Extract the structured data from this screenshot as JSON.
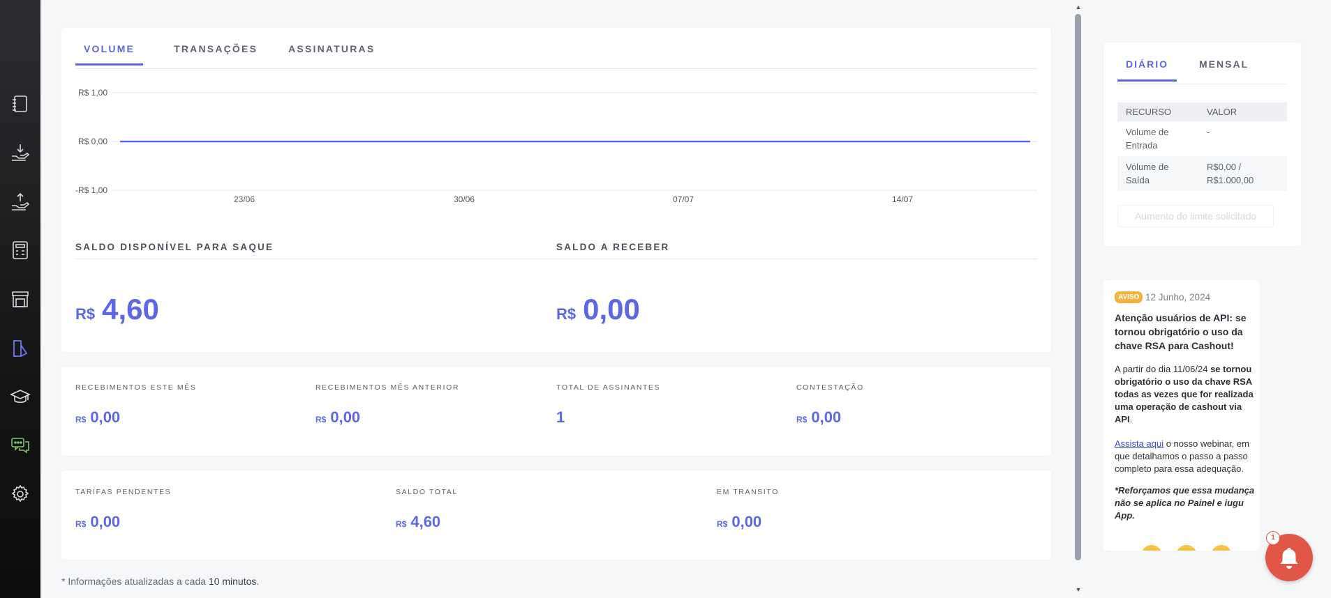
{
  "sidebar": {
    "items": [
      {
        "icon": "notebook-icon"
      },
      {
        "icon": "receive-money-icon"
      },
      {
        "icon": "send-money-icon"
      },
      {
        "icon": "calculator-icon"
      },
      {
        "icon": "store-icon"
      },
      {
        "icon": "reports-icon",
        "active": true
      },
      {
        "icon": "graduation-cap-icon"
      },
      {
        "icon": "chat-icon"
      },
      {
        "icon": "gear-icon"
      }
    ]
  },
  "main_tabs": [
    {
      "label": "VOLUME",
      "active": true
    },
    {
      "label": "TRANSAÇÕES",
      "active": false
    },
    {
      "label": "ASSINATURAS",
      "active": false
    }
  ],
  "chart_data": {
    "type": "line",
    "y_tick_labels": [
      "R$ 1,00",
      "R$ 0,00",
      "-R$ 1,00"
    ],
    "y_ticks": [
      1,
      0,
      -1
    ],
    "ylim": [
      -1,
      1
    ],
    "x_tick_labels": [
      "23/06",
      "30/06",
      "07/07",
      "14/07"
    ],
    "series": [
      {
        "x": [
          "17/06",
          "23/06",
          "30/06",
          "07/07",
          "14/07",
          "20/07"
        ],
        "values": [
          0,
          0,
          0,
          0,
          0,
          0
        ],
        "color": "#5b67e6"
      }
    ],
    "grid": true
  },
  "balance": {
    "available_title": "SALDO DISPONÍVEL PARA SAQUE",
    "available_currency": "R$",
    "available_value": "4,60",
    "receivable_title": "SALDO A RECEBER",
    "receivable_currency": "R$",
    "receivable_value": "0,00"
  },
  "stats_row1": [
    {
      "label": "RECEBIMENTOS ESTE MÊS",
      "currency": "R$",
      "value": "0,00"
    },
    {
      "label": "RECEBIMENTOS MÊS ANTERIOR",
      "currency": "R$",
      "value": "0,00"
    },
    {
      "label": "TOTAL DE ASSINANTES",
      "currency": "",
      "value": "1"
    },
    {
      "label": "CONTESTAÇÃO",
      "currency": "R$",
      "value": "0,00"
    }
  ],
  "stats_row2": [
    {
      "label": "TARIFAS PENDENTES",
      "currency": "R$",
      "value": "0,00"
    },
    {
      "label": "SALDO TOTAL",
      "currency": "R$",
      "value": "4,60"
    },
    {
      "label": "EM TRANSITO",
      "currency": "R$",
      "value": "0,00"
    }
  ],
  "footnote": {
    "prefix": "* Informações atualizadas a cada ",
    "bold": "10 minutos",
    "suffix": "."
  },
  "right_tabs": [
    {
      "label": "DIÁRIO",
      "active": true
    },
    {
      "label": "MENSAL",
      "active": false
    }
  ],
  "limits_table": {
    "headers": [
      "RECURSO",
      "VALOR"
    ],
    "rows": [
      {
        "resource": "Volume de Entrada",
        "value": "-"
      },
      {
        "resource": "Volume de Saída",
        "value": "R$0,00 / R$1.000,00"
      }
    ],
    "button_label": "Aumento do limite solicitado"
  },
  "notice": {
    "badge": "AVISO",
    "date": "12 Junho, 2024",
    "title": "Atenção usuários de API: se tornou obrigatório o uso da chave RSA para Cashout!",
    "body1_prefix": "A partir do dia 11/06/24 ",
    "body1_bold": "se tornou obrigatório o uso da chave RSA todas as vezes que for realizada uma operação de cashout via API",
    "body1_suffix": ".",
    "link_text": "Assista aqui",
    "body2": " o nosso webinar, em que detalhamos o passo a passo completo para essa adequação.",
    "note": "*Reforçamos que essa mudança não se aplica no Painel e iugu App."
  },
  "notifications": {
    "count": "1",
    "icon": "bell-icon"
  }
}
